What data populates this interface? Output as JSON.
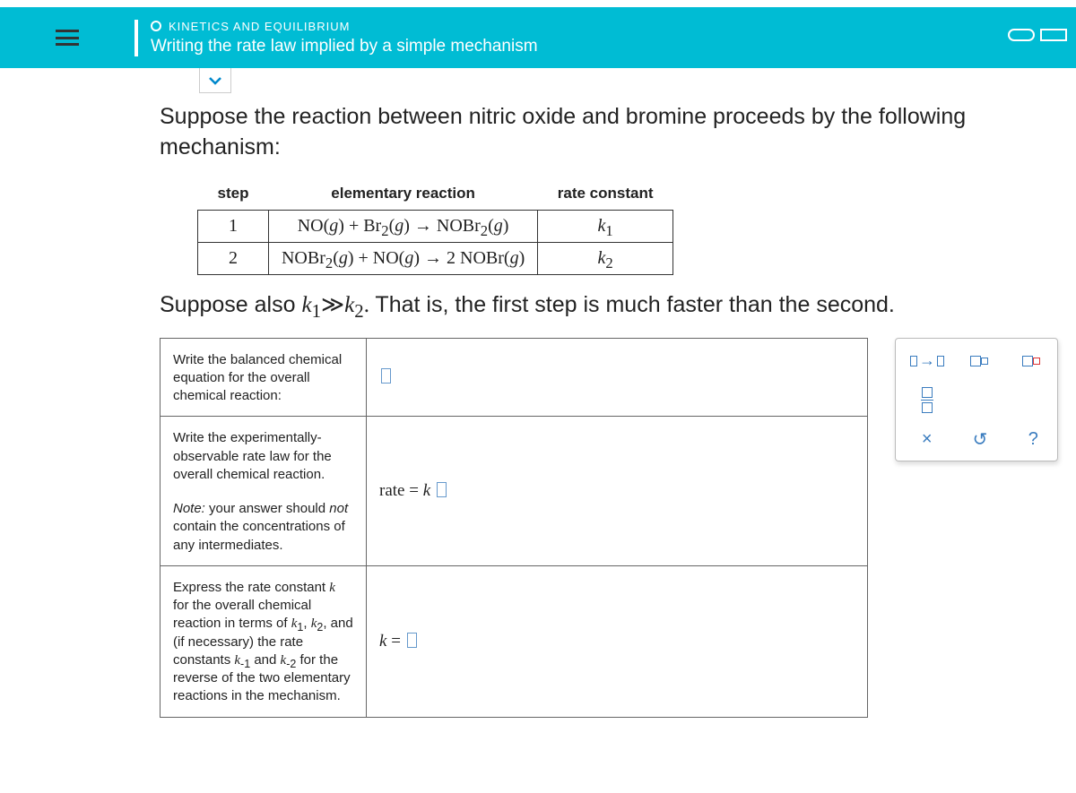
{
  "header": {
    "crumb": "KINETICS AND EQUILIBRIUM",
    "title": "Writing the rate law implied by a simple mechanism"
  },
  "intro": "Suppose the reaction between nitric oxide and bromine proceeds by the following mechanism:",
  "mech": {
    "headers": {
      "step": "step",
      "reaction": "elementary reaction",
      "rate": "rate constant"
    },
    "rows": [
      {
        "step": "1",
        "reaction_html": "NO(<i>g</i>) + Br<sub>2</sub>(<i>g</i>) → NOBr<sub>2</sub>(<i>g</i>)",
        "k": "k",
        "ksub": "1"
      },
      {
        "step": "2",
        "reaction_html": "NOBr<sub>2</sub>(<i>g</i>) + NO(<i>g</i>) → 2 NOBr(<i>g</i>)",
        "k": "k",
        "ksub": "2"
      }
    ]
  },
  "suppose2_pre": "Suppose also ",
  "suppose2_math": "k₁≫k₂.",
  "suppose2_post": " That is, the first step is much faster than the second.",
  "prompts": {
    "p1": "Write the balanced chemical equation for the overall chemical reaction:",
    "p2": "Write the experimentally-observable rate law for the overall chemical reaction.",
    "p2_note_pre": "Note:",
    "p2_note_mid": " your answer should ",
    "p2_note_not": "not",
    "p2_note_post": " contain the concentrations of any intermediates.",
    "p3_a": "Express the rate constant ",
    "p3_k": "k",
    "p3_b": " for the overall chemical reaction in terms of ",
    "p3_k1": "k₁",
    "p3_c": ", ",
    "p3_k2": "k₂",
    "p3_d": ", and (if necessary) the rate constants ",
    "p3_km1": "k₋₁",
    "p3_e": " and ",
    "p3_km2": "k₋₂",
    "p3_f": " for the reverse of the two elementary reactions in the mechanism."
  },
  "answers": {
    "rate_prefix": "rate = ",
    "rate_k": "k",
    "k_prefix": "k",
    "k_eq": " = "
  },
  "toolbox": {
    "arrow": "→",
    "times": "×",
    "undo": "↺",
    "help": "?"
  }
}
